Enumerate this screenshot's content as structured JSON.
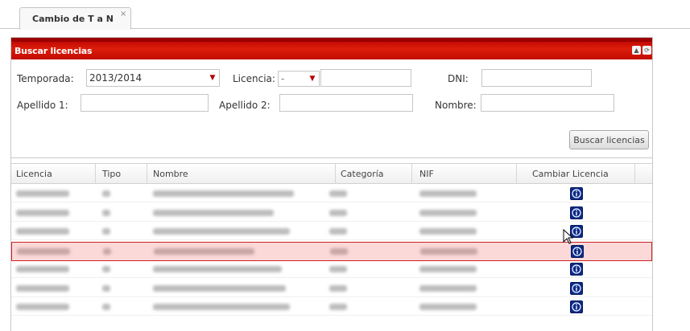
{
  "tabs": [
    {
      "label": "Cambio de T a N",
      "close": "×"
    }
  ],
  "panel": {
    "title": "Buscar licencias"
  },
  "form": {
    "temporada": {
      "label": "Temporada:",
      "value": "2013/2014"
    },
    "licencia": {
      "label": "Licencia:",
      "select_value": "-",
      "input_value": ""
    },
    "dni": {
      "label": "DNI:",
      "value": ""
    },
    "apellido1": {
      "label": "Apellido 1:",
      "value": ""
    },
    "apellido2": {
      "label": "Apellido 2:",
      "value": ""
    },
    "nombre": {
      "label": "Nombre:",
      "value": ""
    }
  },
  "search_button": "Buscar licencias",
  "grid": {
    "columns": [
      "Licencia",
      "Tipo",
      "Nombre",
      "Categoría",
      "NIF",
      "Cambiar Licencia"
    ],
    "row_count": 7,
    "selected_row": 3,
    "row_action_icon": "info-icon",
    "note_rows": "row cell contents are pixelated / obscured in the screenshot"
  },
  "colors": {
    "header_red": "#d01a0a",
    "selected_row_bg": "#fbd9d9",
    "selected_row_border": "#d02020",
    "info_button": "#0a2a8c"
  }
}
